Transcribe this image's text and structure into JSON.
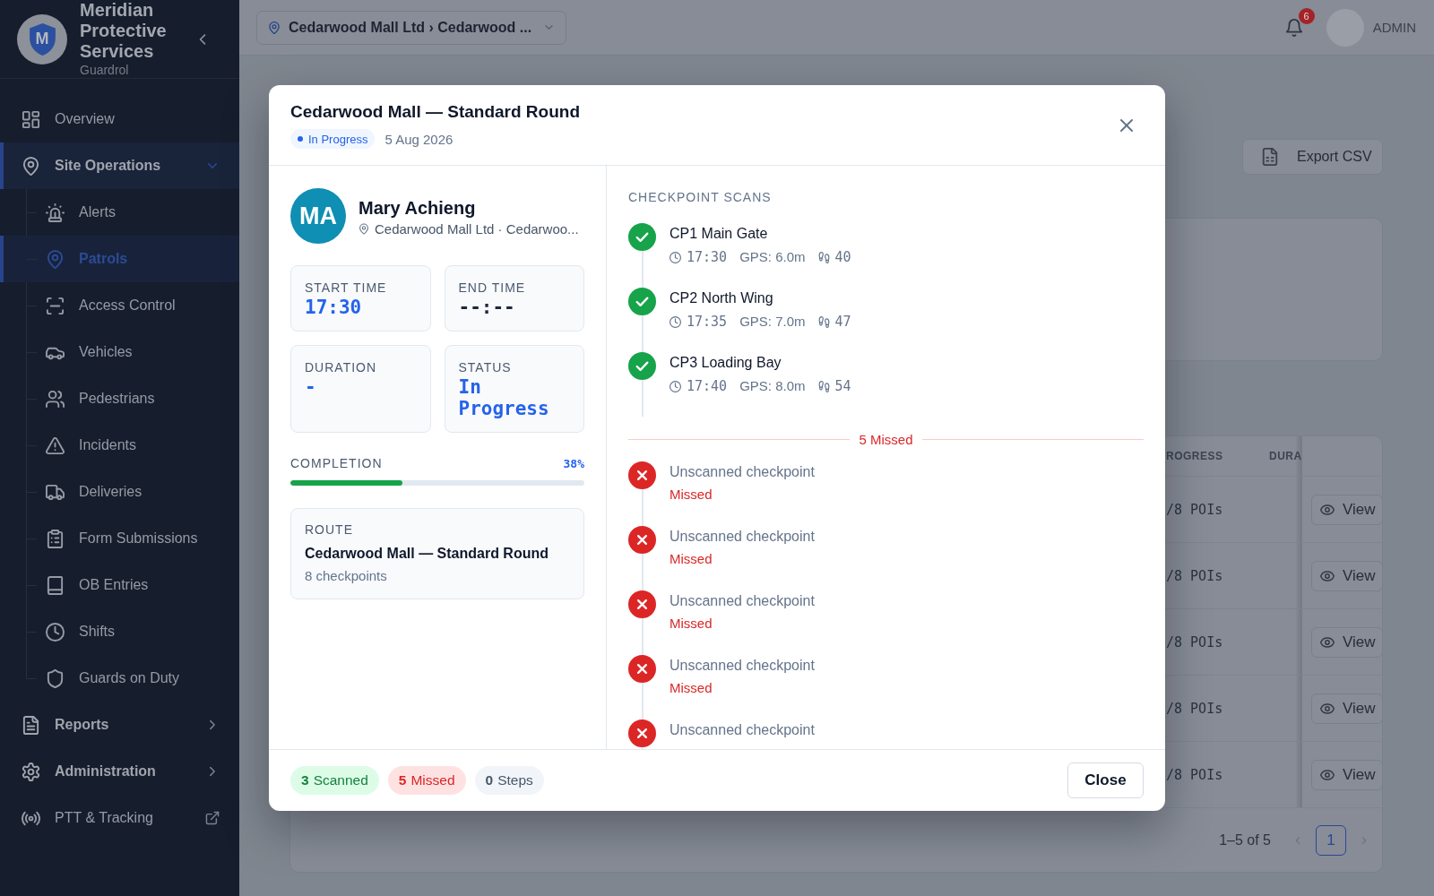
{
  "sidebar": {
    "logo_letter": "M",
    "org_name": "Meridian Protective Services",
    "product": "Guardrol",
    "items": [
      {
        "label": "Overview",
        "kind": "link",
        "selected": false
      },
      {
        "label": "Site Operations",
        "kind": "group",
        "selected": true,
        "expanded": true,
        "children": [
          {
            "label": "Alerts",
            "selected": false
          },
          {
            "label": "Patrols",
            "selected": true
          },
          {
            "label": "Access Control",
            "selected": false
          },
          {
            "label": "Vehicles",
            "selected": false
          },
          {
            "label": "Pedestrians",
            "selected": false
          },
          {
            "label": "Incidents",
            "selected": false
          },
          {
            "label": "Deliveries",
            "selected": false
          },
          {
            "label": "Form Submissions",
            "selected": false
          },
          {
            "label": "OB Entries",
            "selected": false
          },
          {
            "label": "Shifts",
            "selected": false
          },
          {
            "label": "Guards on Duty",
            "selected": false
          }
        ]
      },
      {
        "label": "Reports",
        "kind": "group",
        "selected": false,
        "expanded": false
      },
      {
        "label": "Administration",
        "kind": "group",
        "selected": false,
        "expanded": false
      },
      {
        "label": "PTT & Tracking",
        "kind": "external",
        "selected": false
      }
    ]
  },
  "topbar": {
    "site_selector": "Cedarwood Mall Ltd › Cedarwood ...",
    "notification_count": "6",
    "user": "ADMIN"
  },
  "page": {
    "export_button": "Export CSV",
    "table": {
      "columns": [
        "ROGRESS",
        "DURA"
      ],
      "rows": [
        {
          "progress": "/8 POIs",
          "action": "View"
        },
        {
          "progress": "/8 POIs",
          "action": "View"
        },
        {
          "progress": "/8 POIs",
          "action": "View"
        },
        {
          "progress": "/8 POIs",
          "action": "View"
        },
        {
          "progress": "/8 POIs",
          "action": "View"
        }
      ]
    },
    "pagination": {
      "range": "1–5 of 5",
      "pages": [
        {
          "label": "1",
          "selected": true
        }
      ]
    }
  },
  "modal": {
    "title": "Cedarwood Mall — Standard Round",
    "status_badge": "In Progress",
    "date": "5 Aug 2026",
    "guard": {
      "initials": "MA",
      "name": "Mary Achieng",
      "location": "Cedarwood Mall Ltd · Cedarwoo..."
    },
    "stats": [
      {
        "label": "START TIME",
        "value": "17:30",
        "kind": "value"
      },
      {
        "label": "END TIME",
        "value": "--:--",
        "kind": "placeholder"
      },
      {
        "label": "DURATION",
        "value": "-",
        "kind": "value"
      },
      {
        "label": "STATUS",
        "value": "In Progress",
        "kind": "value"
      }
    ],
    "completion": {
      "label": "COMPLETION",
      "reading": "38%",
      "level": 0.38
    },
    "route": {
      "label": "ROUTE",
      "name": "Cedarwood Mall — Standard Round",
      "checkpoints": "8 checkpoints"
    },
    "checkpoint_scans": {
      "heading": "CHECKPOINT SCANS",
      "scanned": [
        {
          "kind": "scanned",
          "name": "CP1 Main Gate",
          "time": "17:30",
          "gps": "GPS: 6.0m",
          "steps": "40"
        },
        {
          "kind": "scanned",
          "name": "CP2 North Wing",
          "time": "17:35",
          "gps": "GPS: 7.0m",
          "steps": "47"
        },
        {
          "kind": "scanned",
          "name": "CP3 Loading Bay",
          "time": "17:40",
          "gps": "GPS: 8.0m",
          "steps": "54"
        }
      ],
      "missed_divider": "5 Missed",
      "missed": [
        {
          "kind": "missed",
          "name": "Unscanned checkpoint",
          "status": "Missed"
        },
        {
          "kind": "missed",
          "name": "Unscanned checkpoint",
          "status": "Missed"
        },
        {
          "kind": "missed",
          "name": "Unscanned checkpoint",
          "status": "Missed"
        },
        {
          "kind": "missed",
          "name": "Unscanned checkpoint",
          "status": "Missed"
        },
        {
          "kind": "missed",
          "name": "Unscanned checkpoint"
        }
      ]
    },
    "footer": {
      "summary": [
        {
          "kind": "scanned",
          "text": "**3** Scanned"
        },
        {
          "kind": "missed",
          "text": "**5** Missed"
        },
        {
          "kind": "steps",
          "text": "**0** Steps"
        }
      ],
      "close_button": "Close"
    }
  }
}
